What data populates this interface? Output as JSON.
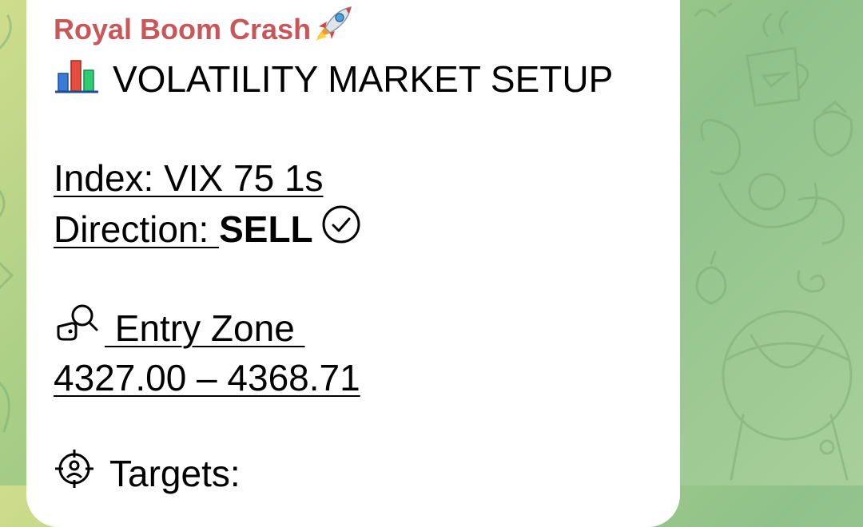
{
  "background": {
    "color_light": "#cfdc8c",
    "color_dark": "#8fc28a"
  },
  "message": {
    "sender": "Royal Boom Crash",
    "sender_icon": "rocket-icon",
    "sender_color": "#c8575a",
    "title_icon": "bar-chart-icon",
    "title": "VOLATILITY MARKET SETUP",
    "index_label": "Index: VIX 75 1s",
    "direction_label": "Direction: ",
    "direction_value": "SELL",
    "direction_icon": "check-circle-icon",
    "entry_icon": "search-tag-icon",
    "entry_label": " Entry Zone ",
    "entry_range": "4327.00 – 4368.71",
    "targets_icon": "target-icon",
    "targets_label": "Targets:"
  }
}
